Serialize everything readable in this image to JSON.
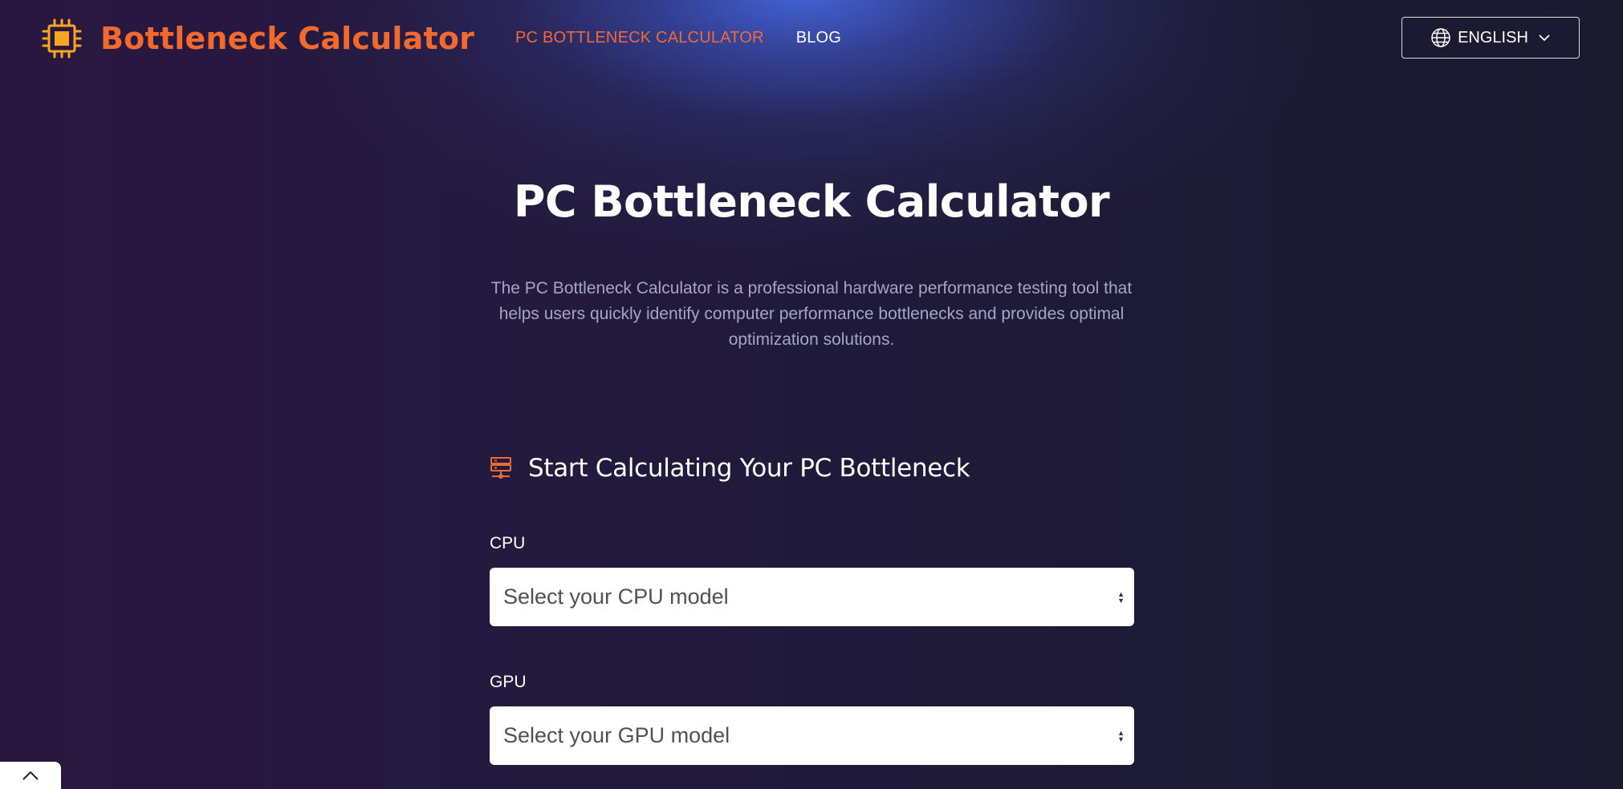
{
  "brand": {
    "name": "Bottleneck Calculator",
    "icon": "cpu-chip-icon",
    "color": "#f06a30"
  },
  "nav": {
    "items": [
      {
        "label": "PC BOTTLENECK CALCULATOR",
        "active": true
      },
      {
        "label": "BLOG",
        "active": false
      }
    ]
  },
  "language": {
    "label": "ENGLISH",
    "icon": "globe-icon",
    "dropdown_icon": "chevron-down-icon"
  },
  "hero": {
    "title": "PC Bottleneck Calculator",
    "description": "The PC Bottleneck Calculator is a professional hardware performance testing tool that helps users quickly identify computer performance bottlenecks and provides optimal optimization solutions."
  },
  "calculator": {
    "heading": "Start Calculating Your PC Bottleneck",
    "heading_icon": "server-icon",
    "cpu": {
      "label": "CPU",
      "placeholder": "Select your CPU model"
    },
    "gpu": {
      "label": "GPU",
      "placeholder": "Select your GPU model"
    }
  },
  "scroll_top": {
    "icon": "chevron-up-icon"
  },
  "colors": {
    "accent": "#f26a36",
    "background": "#1e1834",
    "text_muted": "#a4a7c4"
  }
}
